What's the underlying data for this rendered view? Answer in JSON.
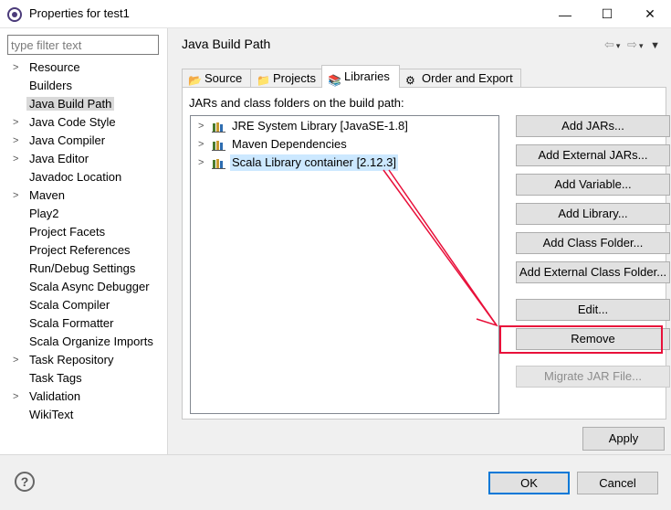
{
  "window": {
    "title": "Properties for test1",
    "app_icon": "eclipse-icon",
    "controls": {
      "minimize": "—",
      "maximize": "☐",
      "close": "✕"
    }
  },
  "sidebar": {
    "filter_placeholder": "type filter text",
    "items": [
      {
        "label": "Resource",
        "expandable": true
      },
      {
        "label": "Builders",
        "expandable": false
      },
      {
        "label": "Java Build Path",
        "expandable": false,
        "selected": true
      },
      {
        "label": "Java Code Style",
        "expandable": true
      },
      {
        "label": "Java Compiler",
        "expandable": true
      },
      {
        "label": "Java Editor",
        "expandable": true
      },
      {
        "label": "Javadoc Location",
        "expandable": false
      },
      {
        "label": "Maven",
        "expandable": true
      },
      {
        "label": "Play2",
        "expandable": false
      },
      {
        "label": "Project Facets",
        "expandable": false
      },
      {
        "label": "Project References",
        "expandable": false
      },
      {
        "label": "Run/Debug Settings",
        "expandable": false
      },
      {
        "label": "Scala Async Debugger",
        "expandable": false
      },
      {
        "label": "Scala Compiler",
        "expandable": false
      },
      {
        "label": "Scala Formatter",
        "expandable": false
      },
      {
        "label": "Scala Organize Imports",
        "expandable": false
      },
      {
        "label": "Task Repository",
        "expandable": true
      },
      {
        "label": "Task Tags",
        "expandable": false
      },
      {
        "label": "Validation",
        "expandable": true
      },
      {
        "label": "WikiText",
        "expandable": false
      }
    ]
  },
  "main": {
    "title": "Java Build Path",
    "tabs": [
      {
        "label": "Source",
        "icon": "source-folder-icon"
      },
      {
        "label": "Projects",
        "icon": "folder-icon"
      },
      {
        "label": "Libraries",
        "icon": "library-icon",
        "active": true
      },
      {
        "label": "Order and Export",
        "icon": "order-export-icon"
      }
    ],
    "panel_label": "JARs and class folders on the build path:",
    "tree": [
      {
        "label": "JRE System Library [JavaSE-1.8]"
      },
      {
        "label": "Maven Dependencies"
      },
      {
        "label": "Scala Library container [2.12.3]",
        "selected": true
      }
    ],
    "buttons": {
      "add_jars": "Add JARs...",
      "add_external_jars": "Add External JARs...",
      "add_variable": "Add Variable...",
      "add_library": "Add Library...",
      "add_class_folder": "Add Class Folder...",
      "add_external_class_folder": "Add External Class Folder...",
      "edit": "Edit...",
      "remove": "Remove",
      "migrate_jar": "Migrate JAR File..."
    },
    "apply": "Apply"
  },
  "footer": {
    "help": "?",
    "ok": "OK",
    "cancel": "Cancel"
  },
  "colors": {
    "highlight": "#e8103a",
    "selection": "#cce8ff",
    "default_button_border": "#0078d7"
  }
}
